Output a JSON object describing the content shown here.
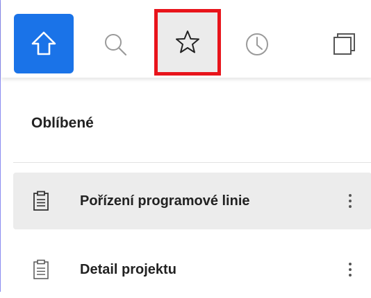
{
  "toolbar": {
    "buttons": [
      {
        "icon": "home-icon",
        "active": true
      },
      {
        "icon": "search-icon"
      },
      {
        "icon": "star-icon",
        "highlighted": true
      },
      {
        "icon": "clock-icon"
      },
      {
        "icon": "windows-icon"
      }
    ],
    "colors": {
      "accent": "#1a73e8",
      "highlight_border": "#e8141b"
    }
  },
  "favorites": {
    "title": "Oblíbené",
    "items": [
      {
        "label": "Pořízení programové linie",
        "icon": "document-icon",
        "selected": true
      },
      {
        "label": "Detail projektu",
        "icon": "document-icon",
        "selected": false
      }
    ]
  }
}
